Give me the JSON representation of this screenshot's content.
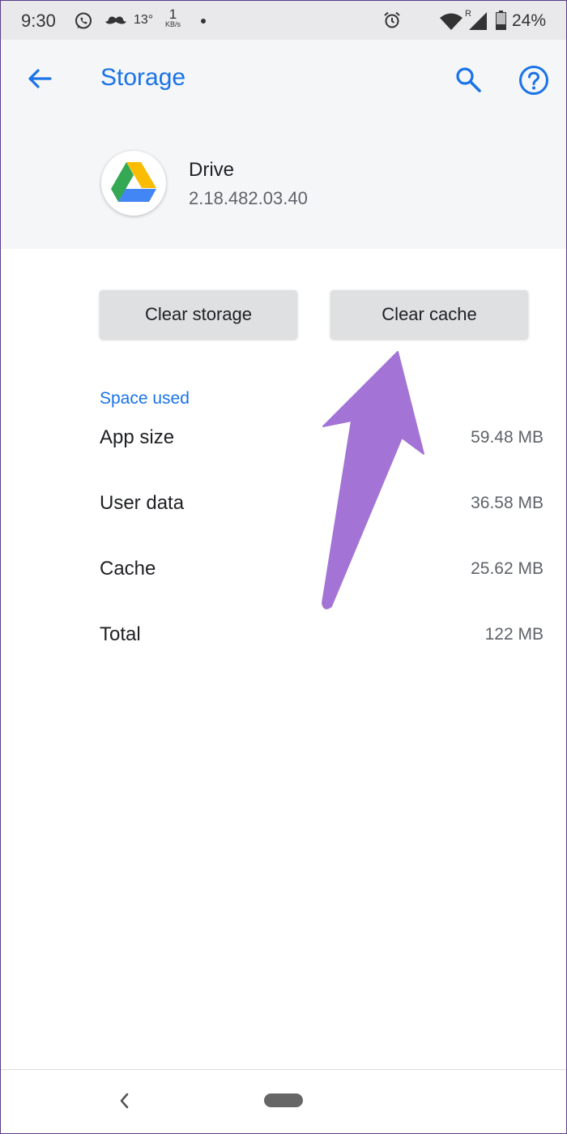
{
  "status_bar": {
    "time": "9:30",
    "temperature": "13°",
    "net_speed_value": "1",
    "net_speed_unit": "KB/s",
    "battery_percent": "24%"
  },
  "header": {
    "title": "Storage",
    "app_name": "Drive",
    "app_version": "2.18.482.03.40"
  },
  "actions": {
    "clear_storage_label": "Clear storage",
    "clear_cache_label": "Clear cache"
  },
  "space_used": {
    "header": "Space used",
    "rows": [
      {
        "label": "App size",
        "value": "59.48 MB"
      },
      {
        "label": "User data",
        "value": "36.58 MB"
      },
      {
        "label": "Cache",
        "value": "25.62 MB"
      },
      {
        "label": "Total",
        "value": "122 MB"
      }
    ]
  },
  "colors": {
    "accent": "#1a73e8",
    "arrow": "#a374d5"
  }
}
